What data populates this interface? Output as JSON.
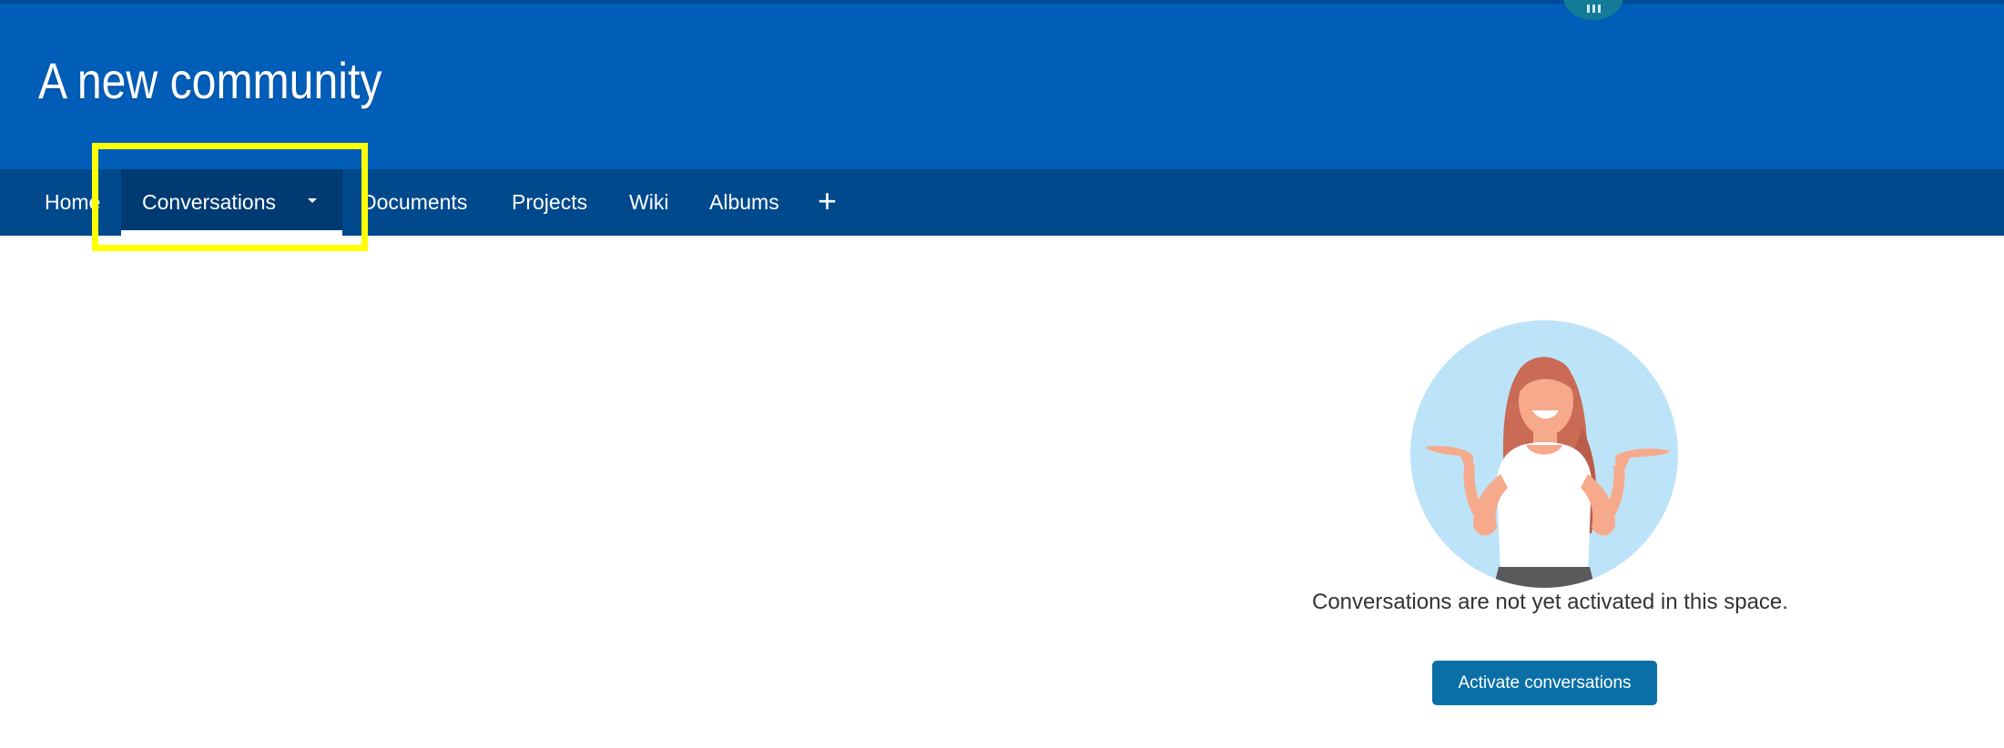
{
  "header": {
    "title": "A new community",
    "app_launcher_icon": "grid-launcher-icon"
  },
  "nav": {
    "items": [
      {
        "label": "Home"
      },
      {
        "label": "Conversations",
        "active": true,
        "has_dropdown": true
      },
      {
        "label": "Documents"
      },
      {
        "label": "Projects"
      },
      {
        "label": "Wiki"
      },
      {
        "label": "Albums"
      }
    ],
    "add_label": "+"
  },
  "empty_state": {
    "message": "Conversations are not yet activated in this space.",
    "button_label": "Activate conversations"
  },
  "colors": {
    "banner": "#005eb8",
    "navbar": "#00498d",
    "active_tab": "#003a72",
    "highlight": "#ffff00",
    "button": "#0a6fa6"
  }
}
